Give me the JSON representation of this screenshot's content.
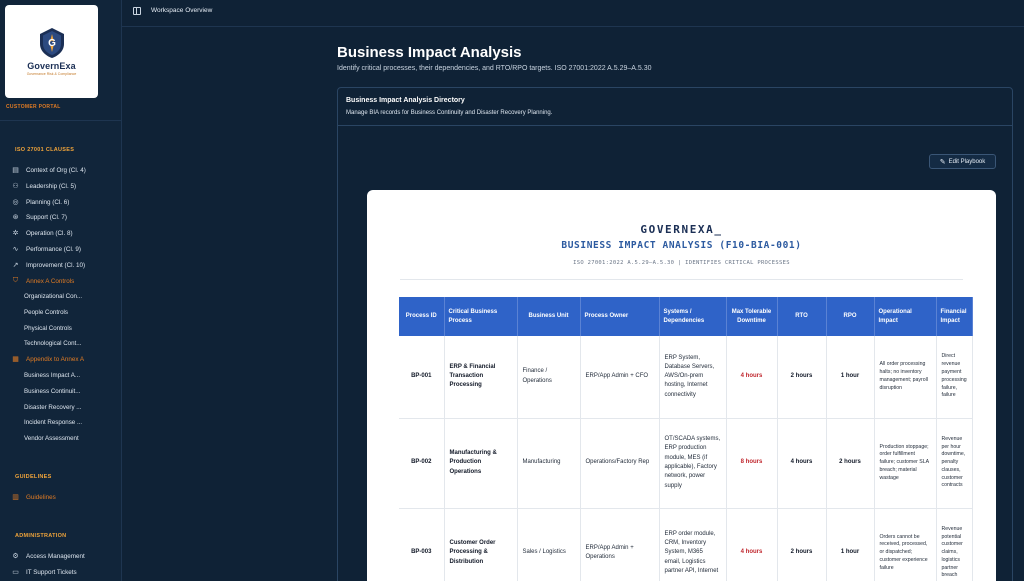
{
  "brand": {
    "logo_name": "GovernExa",
    "logo_tagline": "Governance Risk & Compliance",
    "portal_label": "CUSTOMER PORTAL"
  },
  "sidebar": {
    "iso_title": "ISO 27001 CLAUSES",
    "clauses": [
      {
        "label": "Context of Org (Cl. 4)",
        "icon": "building-icon"
      },
      {
        "label": "Leadership (Cl. 5)",
        "icon": "users-icon"
      },
      {
        "label": "Planning (Cl. 6)",
        "icon": "target-icon"
      },
      {
        "label": "Support (Cl. 7)",
        "icon": "lifebuoy-icon"
      },
      {
        "label": "Operation (Cl. 8)",
        "icon": "gear-icon"
      },
      {
        "label": "Performance (Cl. 9)",
        "icon": "activity-icon"
      },
      {
        "label": "Improvement (Cl. 10)",
        "icon": "trending-up-icon"
      }
    ],
    "annex_controls": {
      "label": "Annex A Controls",
      "icon": "shield-icon"
    },
    "annex_items": [
      "Organizational Con...",
      "People Controls",
      "Physical Controls",
      "Technological Cont..."
    ],
    "appendix": {
      "label": "Appendix to Annex A",
      "icon": "document-icon"
    },
    "appendix_items": [
      "Business Impact A...",
      "Business Continuit...",
      "Disaster Recovery ...",
      "Incident Response ...",
      "Vendor Assessment"
    ],
    "guidelines_title": "GUIDELINES",
    "guidelines_item": {
      "label": "Guidelines",
      "icon": "book-icon"
    },
    "admin_title": "ADMINISTRATION",
    "admin_items": [
      {
        "label": "Access Management",
        "icon": "key-icon"
      },
      {
        "label": "IT Support Tickets",
        "icon": "ticket-icon"
      }
    ]
  },
  "topbar": {
    "breadcrumb": "Workspace Overview"
  },
  "page": {
    "title": "Business Impact Analysis",
    "subtitle": "Identify critical processes, their dependencies, and RTO/RPO targets. ISO 27001:2022 A.5.29–A.5.30"
  },
  "panel": {
    "title": "Business Impact Analysis Directory",
    "subtitle": "Manage BIA records for Business Continuity and Disaster Recovery Planning.",
    "edit_button": "Edit Playbook"
  },
  "document": {
    "brand": "GOVERNEXA_",
    "title": "BUSINESS IMPACT ANALYSIS (F10-BIA-001)",
    "meta": "ISO 27001:2022 A.5.29–A.5.30 | IDENTIFIES CRITICAL PROCESSES",
    "columns": [
      "Process ID",
      "Critical Business Process",
      "Business Unit",
      "Process Owner",
      "Systems / Dependencies",
      "Max Tolerable Downtime",
      "RTO",
      "RPO",
      "Operational Impact",
      "Financial Impact"
    ],
    "rows": [
      {
        "id": "BP-001",
        "process": "ERP & Financial Transaction Processing",
        "unit": "Finance / Operations",
        "owner": "ERP/App Admin + CFO",
        "systems": "ERP System, Database Servers, AWS/On-prem hosting, Internet connectivity",
        "mtd": "4 hours",
        "rto": "2 hours",
        "rpo": "1 hour",
        "operational": "All order processing halts; no inventory management; payroll disruption",
        "financial": "Direct revenue payment processing failure, failure"
      },
      {
        "id": "BP-002",
        "process": "Manufacturing & Production Operations",
        "unit": "Manufacturing",
        "owner": "Operations/Factory Rep",
        "systems": "OT/SCADA systems, ERP production module, MES (if applicable), Factory network, power supply",
        "mtd": "8 hours",
        "rto": "4 hours",
        "rpo": "2 hours",
        "operational": "Production stoppage; order fulfillment failure; customer SLA breach; material wastage",
        "financial": "Revenue per hour downtime, penalty clauses, customer contracts"
      },
      {
        "id": "BP-003",
        "process": "Customer Order Processing & Distribution",
        "unit": "Sales / Logistics",
        "owner": "ERP/App Admin + Operations",
        "systems": "ERP order module, CRM, Inventory System, M365 email, Logistics partner API, Internet",
        "mtd": "4 hours",
        "rto": "2 hours",
        "rpo": "1 hour",
        "operational": "Orders cannot be received, processed, or dispatched; customer experience failure",
        "financial": "Revenue potential customer claims, logistics partner breach"
      }
    ]
  },
  "colors": {
    "accent": "#e07b24",
    "table_header": "#2f63c8",
    "background": "#0f2236",
    "critical": "#c0262d"
  }
}
